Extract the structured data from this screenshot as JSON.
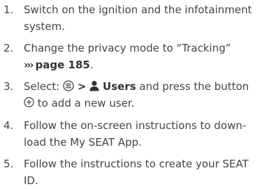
{
  "steps": [
    {
      "number": "1.",
      "lines": [
        "Switch on the ignition and the infotainment",
        "system."
      ]
    },
    {
      "number": "2.",
      "lines": [
        "Change the privacy mode to “Tracking”"
      ],
      "ref_marker": "›››",
      "ref_text": "page 185",
      "ref_end": "."
    },
    {
      "number": "3.",
      "prefix": "Select:",
      "separator": ">",
      "users_label": "Users",
      "suffix": "and press the button",
      "line2_suffix": "to add a new user.",
      "icons": [
        "menu-dots-icon",
        "user-icon",
        "add-circle-icon"
      ]
    },
    {
      "number": "4.",
      "lines": [
        "Follow the on-screen instructions to down-",
        "load the My SEAT App."
      ]
    },
    {
      "number": "5.",
      "lines": [
        "Follow the instructions to create your SEAT",
        "ID."
      ]
    }
  ]
}
